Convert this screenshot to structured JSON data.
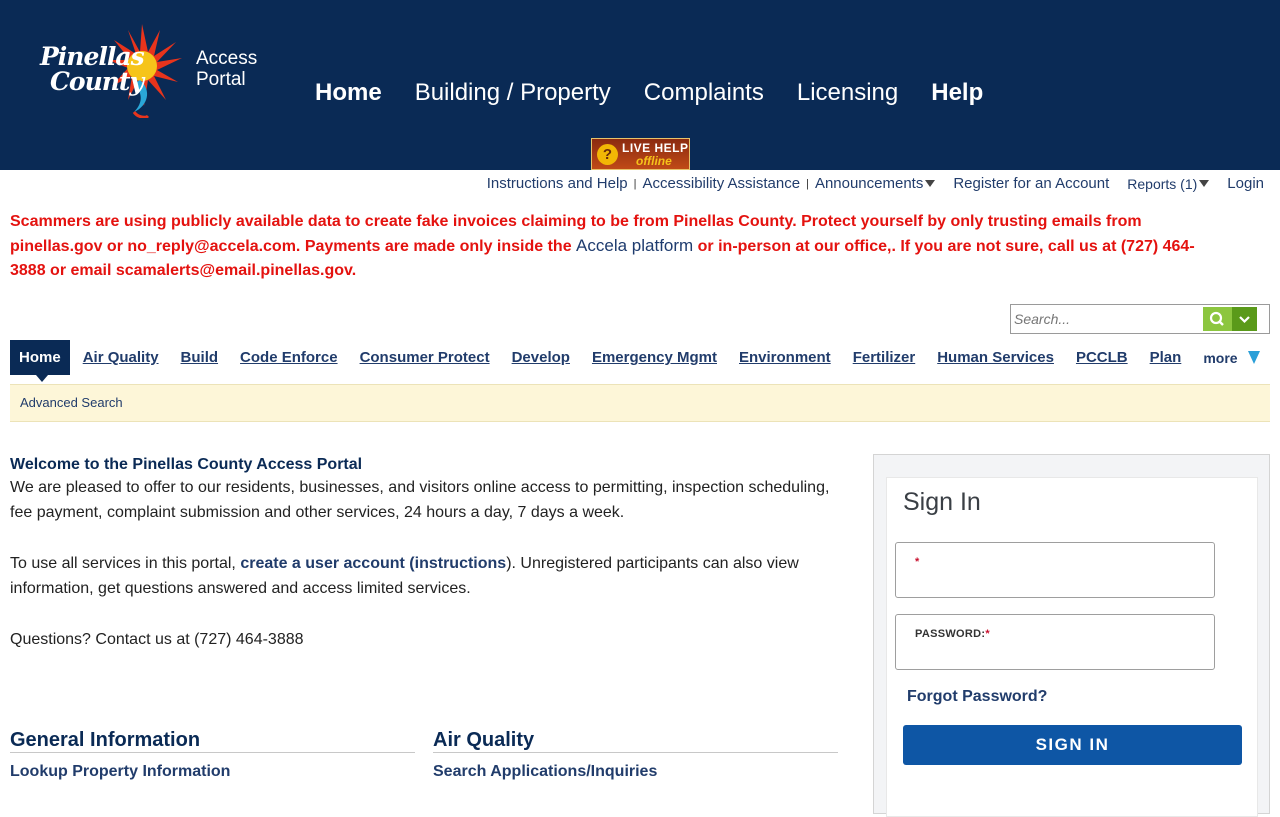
{
  "header": {
    "logo_line1": "Pinellas",
    "logo_line2": "County",
    "portal_line1": "Access",
    "portal_line2": "Portal",
    "nav": [
      {
        "label": "Home"
      },
      {
        "label": "Building / Property"
      },
      {
        "label": "Complaints"
      },
      {
        "label": "Licensing"
      },
      {
        "label": "Help"
      }
    ],
    "live_help": {
      "line1": "LIVE HELP",
      "line2": "offline",
      "icon": "question-icon"
    }
  },
  "utility": {
    "instructions": "Instructions and Help",
    "accessibility": "Accessibility Assistance",
    "announcements": "Announcements",
    "register": "Register for an Account",
    "reports": "Reports (1)",
    "login": "Login"
  },
  "alert": {
    "text_before": "Scammers are using publicly available data to create fake invoices claiming to be from Pinellas County. Protect yourself by only trusting emails from pinellas.gov or no_reply@accela.com. Payments are made only inside the ",
    "link": "Accela platform",
    "text_after": " or in-person at our office,. If you are not sure, call us at (727) 464-3888 or email scamalerts@email.pinellas.gov."
  },
  "search": {
    "placeholder": "Search...",
    "icon": "search-icon",
    "dropdown_icon": "chevron-down-icon"
  },
  "tabs": {
    "items": [
      "Home",
      "Air Quality",
      "Build",
      "Code Enforce",
      "Consumer Protect",
      "Develop",
      "Emergency Mgmt",
      "Environment",
      "Fertilizer",
      "Human Services",
      "PCCLB",
      "Plan"
    ],
    "more": "more"
  },
  "advanced_search": "Advanced Search",
  "welcome": {
    "title": "Welcome to the Pinellas County Access Portal",
    "para1": "We are pleased to offer to our residents, businesses, and visitors online access to permitting, inspection scheduling, fee payment, complaint submission and other services, 24 hours a day, 7 days a week.",
    "para2_before": "To use all services in this portal, ",
    "para2_link": "create a user account (instructions",
    "para2_after": ").  Unregistered participants can also view information, get questions answered and access limited services.",
    "para3": "Questions? Contact us at (727) 464-3888"
  },
  "sections": [
    {
      "title": "General Information",
      "link": "Lookup Property Information"
    },
    {
      "title": "Air Quality",
      "link": "Search Applications/Inquiries"
    }
  ],
  "signin": {
    "title": "Sign In",
    "username_label": "",
    "password_label": "PASSWORD:",
    "required_mark": "*",
    "forgot": "Forgot Password?",
    "button": "SIGN IN"
  }
}
